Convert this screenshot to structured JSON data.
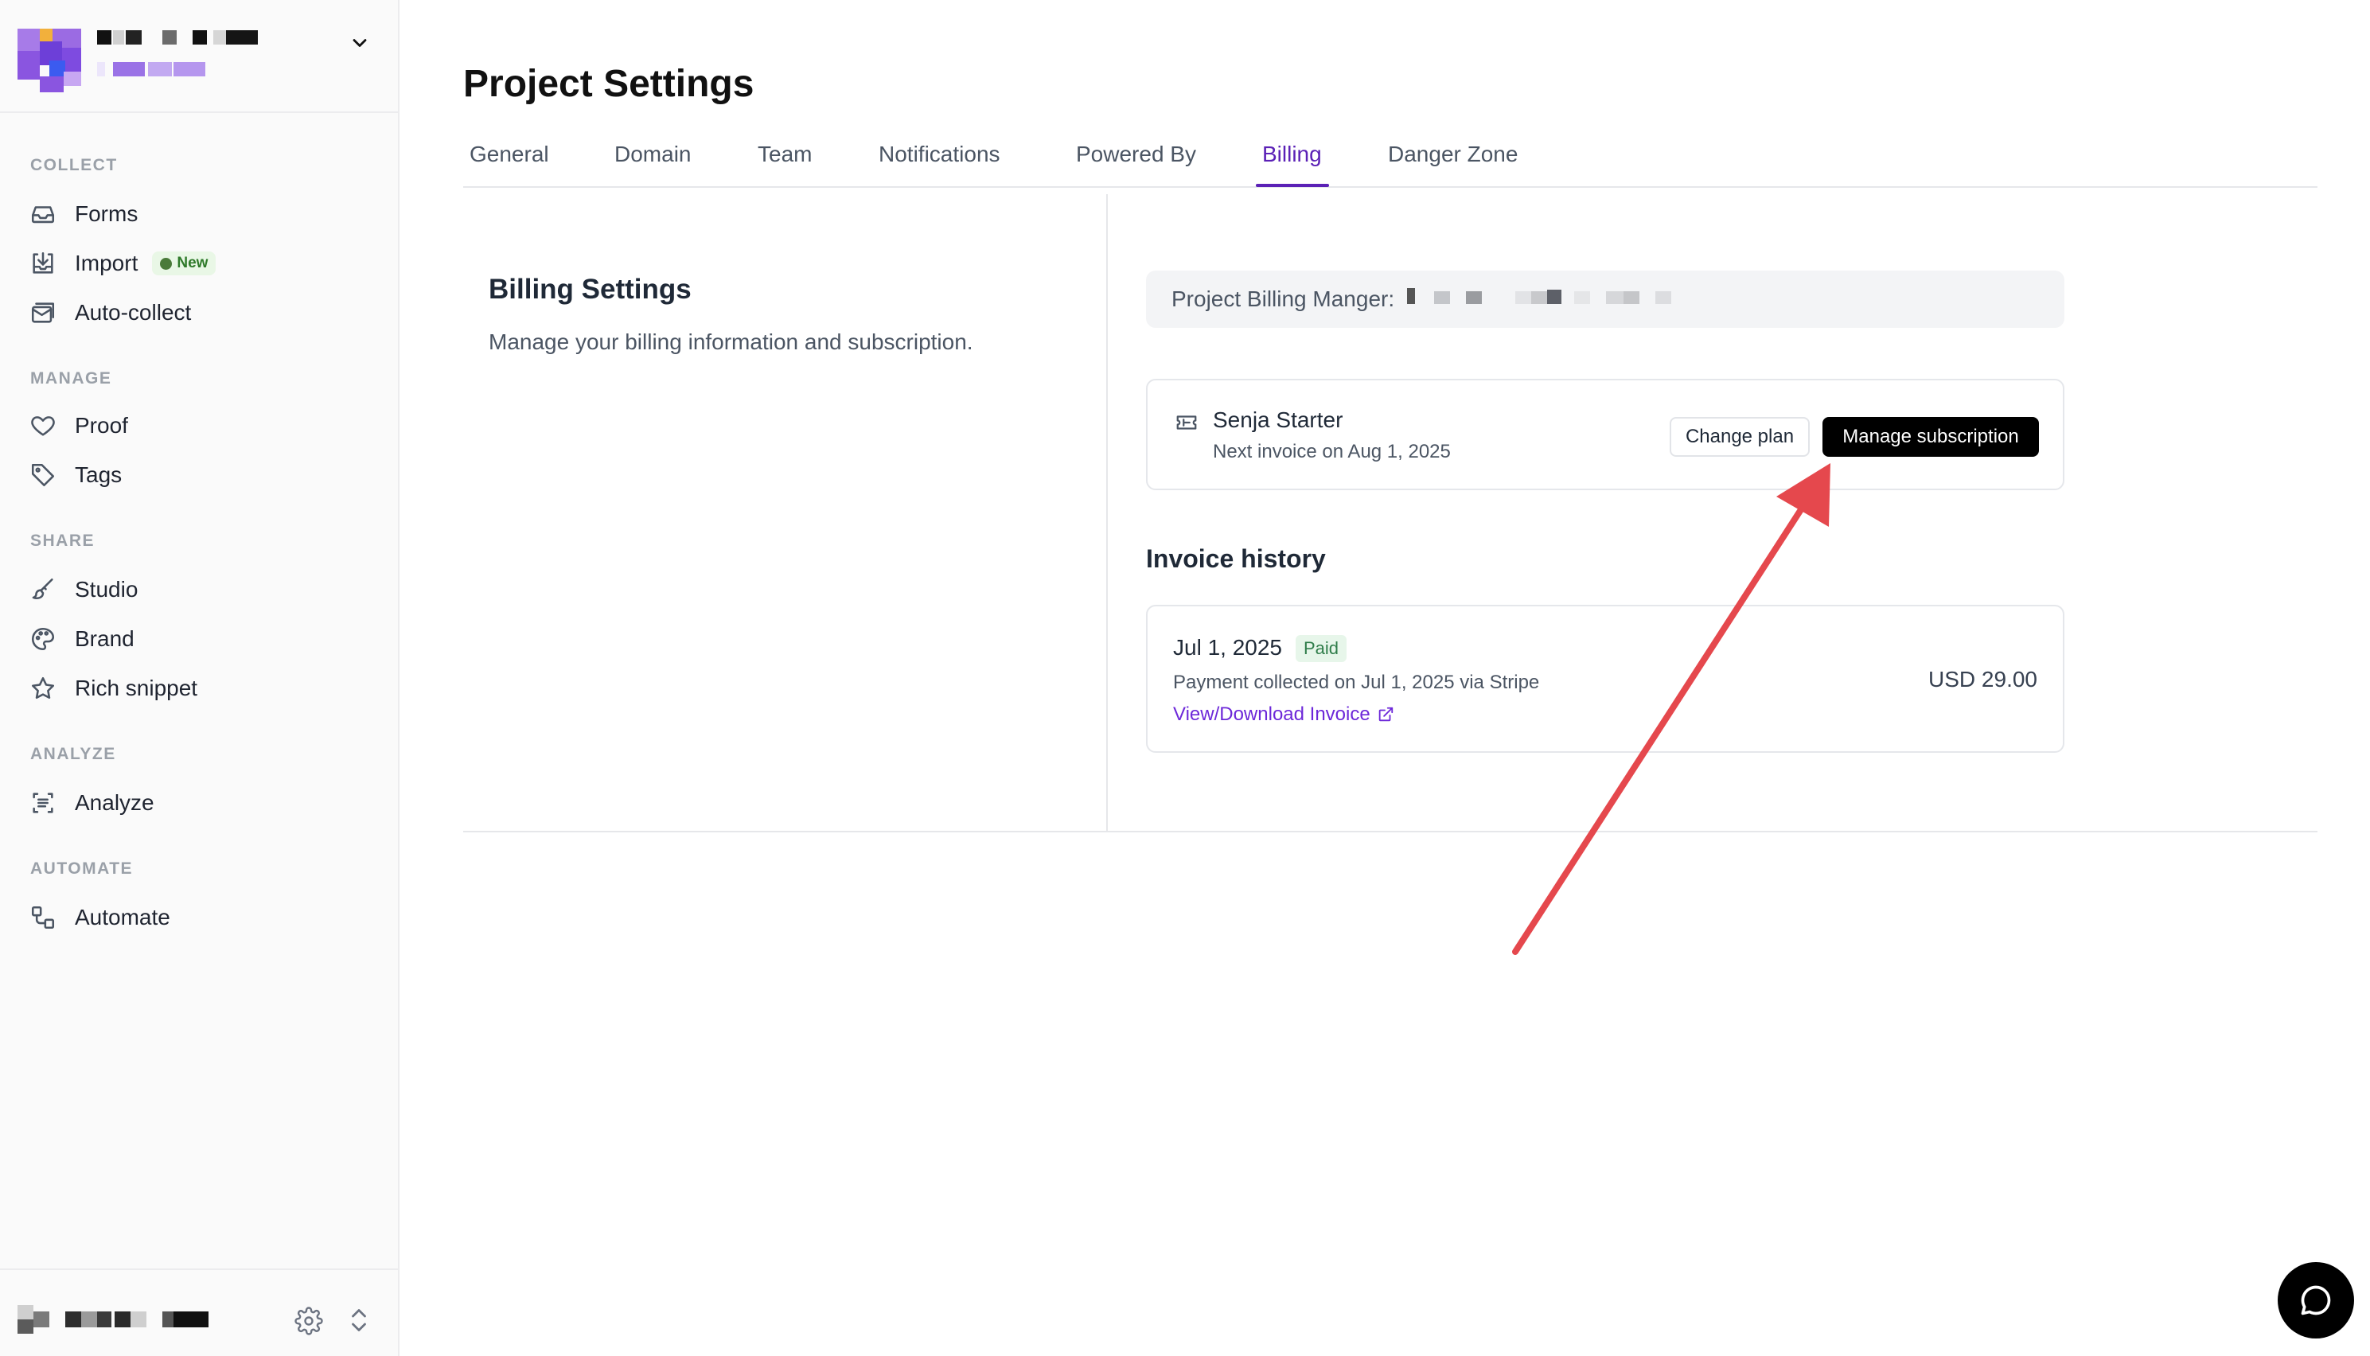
{
  "sidebar": {
    "sections": [
      {
        "label": "COLLECT",
        "items": [
          {
            "label": "Forms",
            "icon": "inbox-icon"
          },
          {
            "label": "Import",
            "icon": "download-icon",
            "badge": "New"
          },
          {
            "label": "Auto-collect",
            "icon": "mail-stack-icon"
          }
        ]
      },
      {
        "label": "MANAGE",
        "items": [
          {
            "label": "Proof",
            "icon": "heart-icon"
          },
          {
            "label": "Tags",
            "icon": "tag-icon"
          }
        ]
      },
      {
        "label": "SHARE",
        "items": [
          {
            "label": "Studio",
            "icon": "brush-icon"
          },
          {
            "label": "Brand",
            "icon": "palette-icon"
          },
          {
            "label": "Rich snippet",
            "icon": "star-icon"
          }
        ]
      },
      {
        "label": "ANALYZE",
        "items": [
          {
            "label": "Analyze",
            "icon": "list-report-icon"
          }
        ]
      },
      {
        "label": "AUTOMATE",
        "items": [
          {
            "label": "Automate",
            "icon": "workflow-icon"
          }
        ]
      }
    ]
  },
  "main": {
    "title": "Project Settings",
    "tabs": [
      "General",
      "Domain",
      "Team",
      "Notifications",
      "Powered By",
      "Billing",
      "Danger Zone"
    ],
    "active_tab": "Billing",
    "billing": {
      "title": "Billing Settings",
      "description": "Manage your billing information and subscription.",
      "manager_label": "Project Billing Manger:",
      "plan": {
        "name": "Senja Starter",
        "next_invoice": "Next invoice on Aug 1, 2025",
        "change_label": "Change plan",
        "manage_label": "Manage subscription"
      },
      "invoice_history_title": "Invoice history",
      "invoices": [
        {
          "date": "Jul 1, 2025",
          "status": "Paid",
          "note": "Payment collected on Jul 1, 2025 via Stripe",
          "link": "View/Download Invoice",
          "amount": "USD 29.00"
        }
      ]
    }
  },
  "colors": {
    "accent": "#5b21b6",
    "annotation_arrow": "#e5484d",
    "paid_badge_bg": "#e7f6ea",
    "primary_button": "#000000"
  }
}
